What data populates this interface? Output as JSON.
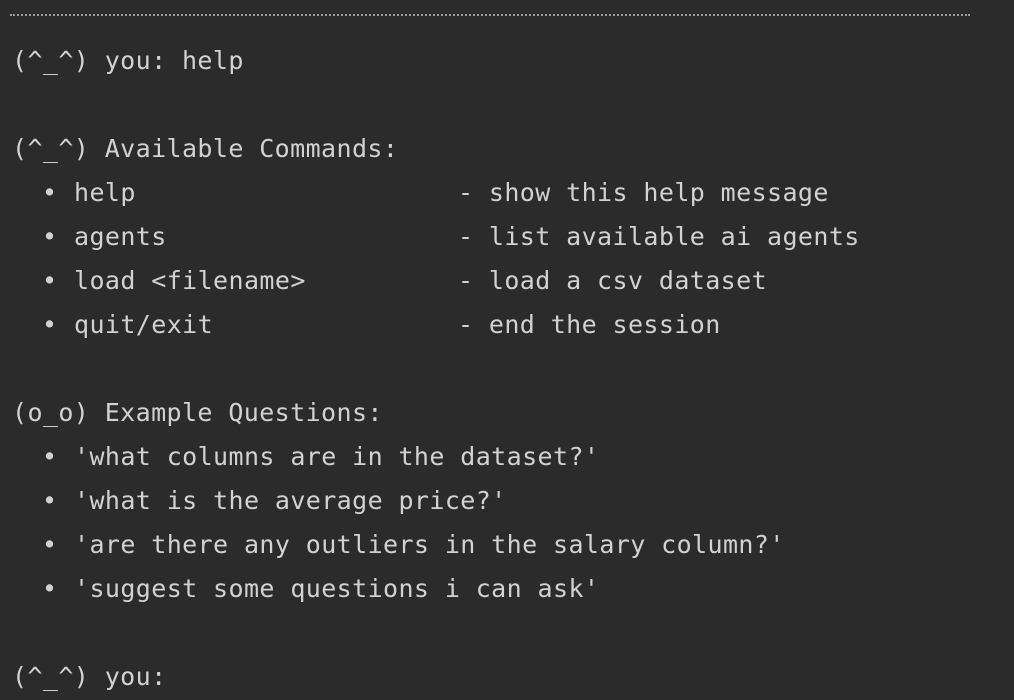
{
  "prompt_face": "(^_^)",
  "prompt_label": "you:",
  "first_input": "help",
  "commands_header": {
    "face": "(^_^)",
    "title": "Available Commands:"
  },
  "bullet_glyph": "•",
  "commands": [
    {
      "command": "help",
      "description": "- show this help message"
    },
    {
      "command": "agents",
      "description": "- list available ai agents"
    },
    {
      "command": "load <filename>",
      "description": "- load a csv dataset"
    },
    {
      "command": "quit/exit",
      "description": "- end the session"
    }
  ],
  "examples_header": {
    "face": "(o_o)",
    "title": "Example Questions:"
  },
  "examples": [
    "'what columns are in the dataset?'",
    "'what is the average price?'",
    "'are there any outliers in the salary column?'",
    "'suggest some questions i can ask'"
  ],
  "final_prompt": {
    "face": "(^_^)",
    "label": "you:",
    "value": ""
  }
}
